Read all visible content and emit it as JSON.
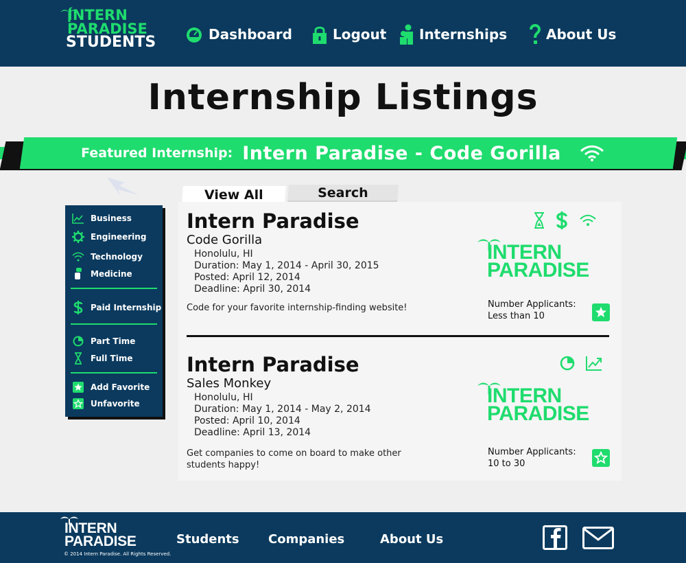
{
  "colors": {
    "navy": "#0b3a5e",
    "green": "#1fdc6e",
    "background": "#efefef"
  },
  "header": {
    "logo": {
      "line1": "INTERN",
      "line2": "PARADISE",
      "line3": "STUDENTS"
    },
    "nav": [
      {
        "label": "Dashboard",
        "icon": "gauge-icon"
      },
      {
        "label": "Logout",
        "icon": "lock-icon"
      },
      {
        "label": "Internships",
        "icon": "people-icon"
      },
      {
        "label": "About Us",
        "icon": "question-icon"
      }
    ]
  },
  "page": {
    "title": "Internship Listings"
  },
  "featured": {
    "label": "Featured Internship:",
    "title": "Intern Paradise - Code Gorilla",
    "icon": "wifi-icon"
  },
  "sidebar": {
    "groups": [
      [
        {
          "label": "Business",
          "icon": "chart-icon"
        },
        {
          "label": "Engineering",
          "icon": "gear-icon"
        },
        {
          "label": "Technology",
          "icon": "wifi-icon"
        },
        {
          "label": "Medicine",
          "icon": "medicine-icon"
        }
      ],
      [
        {
          "label": "Paid Internship",
          "icon": "dollar-icon"
        }
      ],
      [
        {
          "label": "Part Time",
          "icon": "pie-icon"
        },
        {
          "label": "Full Time",
          "icon": "hourglass-icon"
        }
      ],
      [
        {
          "label": "Add Favorite",
          "icon": "star-filled-icon"
        },
        {
          "label": "Unfavorite",
          "icon": "star-outline-icon"
        }
      ]
    ]
  },
  "tabs": {
    "view_all": "View All",
    "search": "Search"
  },
  "listings": [
    {
      "company": "Intern Paradise",
      "position": "Code Gorilla",
      "location": "Honolulu, HI",
      "duration": "Duration: May 1, 2014 - April 30, 2015",
      "posted": "Posted: April 12, 2014",
      "deadline": "Deadline: April 30, 2014",
      "description": "Code for your favorite internship-finding website!",
      "applicants_label": "Number Applicants:",
      "applicants_value": "Less than 10",
      "tags": [
        "hourglass-icon",
        "dollar-icon",
        "wifi-icon"
      ],
      "favorite_icon": "star-filled-icon",
      "logo": {
        "line1": "INTERN",
        "line2": "PARADISE"
      }
    },
    {
      "company": "Intern Paradise",
      "position": "Sales Monkey",
      "location": "Honolulu, HI",
      "duration": "Duration: May 1, 2014 - May 2, 2014",
      "posted": "Posted: April 10, 2014",
      "deadline": "Deadline: April 13, 2014",
      "description": "Get companies to come on board to make other students happy!",
      "applicants_label": "Number Applicants:",
      "applicants_value": "10 to 30",
      "tags": [
        "pie-icon",
        "chart-icon"
      ],
      "favorite_icon": "star-outline-icon",
      "logo": {
        "line1": "INTERN",
        "line2": "PARADISE"
      }
    }
  ],
  "footer": {
    "logo": {
      "line1": "INTERN",
      "line2": "PARADISE"
    },
    "links": [
      "Students",
      "Companies",
      "About Us"
    ],
    "copyright": "© 2014 Intern Paradise. All Rights Reserved.",
    "social": [
      "facebook-icon",
      "mail-icon"
    ]
  }
}
